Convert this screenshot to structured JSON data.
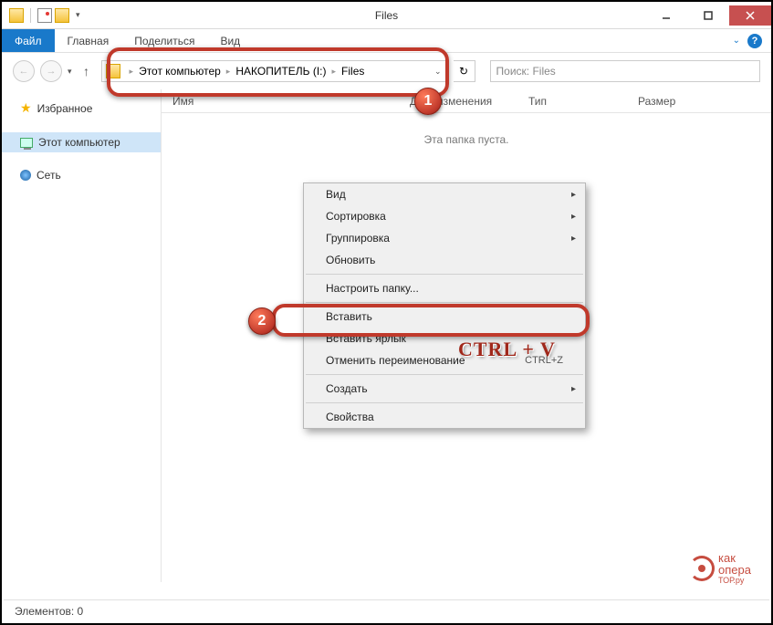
{
  "window": {
    "title": "Files"
  },
  "ribbon": {
    "file": "Файл",
    "tabs": [
      "Главная",
      "Поделиться",
      "Вид"
    ]
  },
  "address": {
    "parts": [
      "Этот компьютер",
      "НАКОПИТЕЛЬ (I:)",
      "Files"
    ]
  },
  "search": {
    "placeholder": "Поиск: Files"
  },
  "sidebar": {
    "favorites": "Избранное",
    "this_pc": "Этот компьютер",
    "network": "Сеть"
  },
  "columns": {
    "name": "Имя",
    "date": "Дата изменения",
    "type": "Тип",
    "size": "Размер"
  },
  "content": {
    "empty": "Эта папка пуста."
  },
  "context_menu": {
    "view": "Вид",
    "sort": "Сортировка",
    "group": "Группировка",
    "refresh": "Обновить",
    "customize": "Настроить папку...",
    "paste": "Вставить",
    "paste_shortcut": "Вставить ярлык",
    "undo_rename": "Отменить переименование",
    "undo_shortcut": "CTRL+Z",
    "new": "Создать",
    "properties": "Свойства"
  },
  "annotations": {
    "badge1": "1",
    "badge2": "2",
    "keyboard": "CTRL + V"
  },
  "statusbar": {
    "items": "Элементов: 0"
  },
  "watermark": {
    "line1": "как",
    "line2": "опера",
    "line3": "ТОР.ру"
  }
}
